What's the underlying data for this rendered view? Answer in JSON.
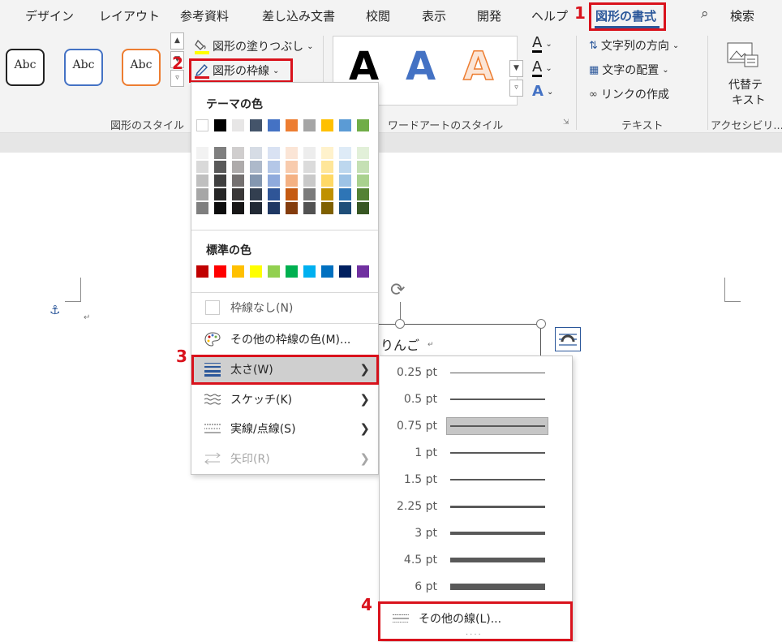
{
  "ribbon": {
    "tabs": [
      "デザイン",
      "レイアウト",
      "参考資料",
      "差し込み文書",
      "校閲",
      "表示",
      "開発",
      "ヘルプ",
      "図形の書式"
    ],
    "active_tab": "図形の書式",
    "search_label": "検索",
    "shape_styles": {
      "sample_text": "Abc",
      "fill_label": "図形の塗りつぶし",
      "outline_label": "図形の枠線",
      "group_label": "図形のスタイル",
      "box_colors": [
        "#222222",
        "#4472c4",
        "#ed7d31"
      ]
    },
    "wordart": {
      "letter": "A",
      "group_label": "ワードアートのスタイル"
    },
    "text_group": {
      "direction_label": "文字列の方向",
      "align_label": "文字の配置",
      "link_label": "リンクの作成",
      "group_label": "テキスト"
    },
    "alt_text": {
      "label_line1": "代替テ",
      "label_line2": "キスト",
      "group_label": "アクセシビリ..."
    }
  },
  "steps": [
    "1",
    "2",
    "3",
    "4"
  ],
  "document": {
    "text": "りんご"
  },
  "menu": {
    "theme_colors_heading": "テーマの色",
    "standard_colors_heading": "標準の色",
    "theme_top_row": [
      "#ffffff",
      "#000000",
      "#e7e6e6",
      "#44546a",
      "#4472c4",
      "#ed7d31",
      "#a5a5a5",
      "#ffc000",
      "#5b9bd5",
      "#70ad47"
    ],
    "theme_shades": [
      [
        "#f2f2f2",
        "#7f7f7f",
        "#d0cece",
        "#d6dce5",
        "#d9e2f3",
        "#fbe5d6",
        "#ededed",
        "#fff2cc",
        "#deebf7",
        "#e2f0d9"
      ],
      [
        "#d9d9d9",
        "#595959",
        "#aeabab",
        "#adb9ca",
        "#b4c7e7",
        "#f8cbad",
        "#dbdbdb",
        "#ffe699",
        "#bdd7ee",
        "#c5e0b4"
      ],
      [
        "#bfbfbf",
        "#404040",
        "#757171",
        "#8497b0",
        "#8faadc",
        "#f4b183",
        "#c9c9c9",
        "#ffd966",
        "#9dc3e6",
        "#a9d18e"
      ],
      [
        "#a6a6a6",
        "#262626",
        "#3a3838",
        "#333f50",
        "#2f5597",
        "#c55a11",
        "#7b7b7b",
        "#bf9000",
        "#2e75b6",
        "#548235"
      ],
      [
        "#7f7f7f",
        "#0d0d0d",
        "#171616",
        "#222a35",
        "#1f3864",
        "#843c0c",
        "#525252",
        "#7f6000",
        "#1f4e79",
        "#385723"
      ]
    ],
    "standard_colors": [
      "#c00000",
      "#ff0000",
      "#ffc000",
      "#ffff00",
      "#92d050",
      "#00b050",
      "#00b0f0",
      "#0070c0",
      "#002060",
      "#7030a0"
    ],
    "no_outline": "枠線なし(N)",
    "more_colors": "その他の枠線の色(M)...",
    "weight": "太さ(W)",
    "sketch": "スケッチ(K)",
    "dashes": "実線/点線(S)",
    "arrows": "矢印(R)"
  },
  "submenu": {
    "weights": [
      "0.25 pt",
      "0.5 pt",
      "0.75 pt",
      "1 pt",
      "1.5 pt",
      "2.25 pt",
      "3 pt",
      "4.5 pt",
      "6 pt"
    ],
    "selected": "0.75 pt",
    "more_lines": "その他の線(L)..."
  }
}
